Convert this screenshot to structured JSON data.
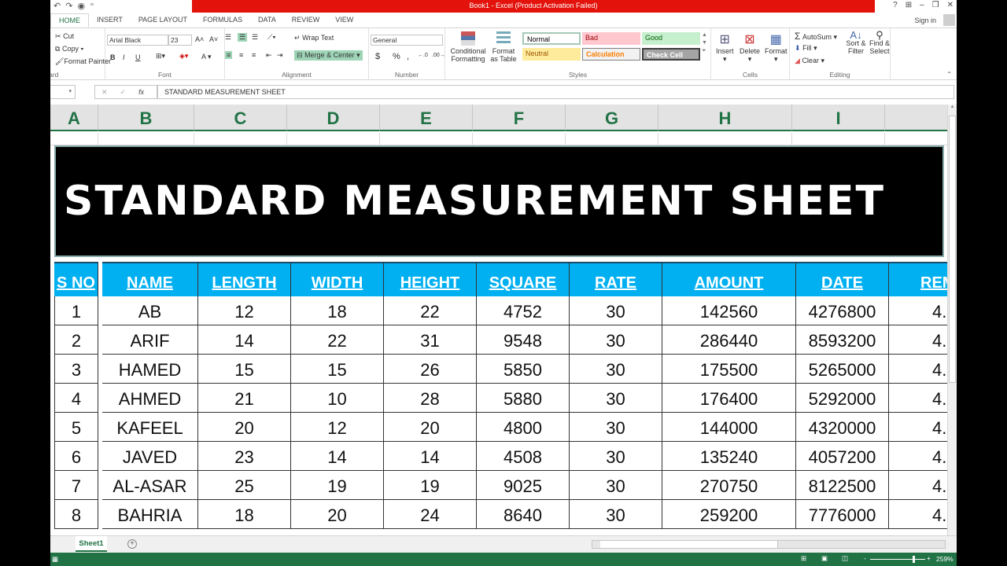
{
  "titlebar": {
    "title": "Book1 -  Excel (Product Activation Failed)",
    "qat": {
      "undo": "↶",
      "redo": "↷",
      "touch": "◉",
      "customize": "⁼"
    },
    "controls": {
      "help": "?",
      "ribbon_options": "⊞",
      "minimize": "–",
      "restore": "❐",
      "close": "✕"
    }
  },
  "tabs": [
    {
      "label": "HOME",
      "active": true
    },
    {
      "label": "INSERT"
    },
    {
      "label": "PAGE LAYOUT"
    },
    {
      "label": "FORMULAS"
    },
    {
      "label": "DATA"
    },
    {
      "label": "REVIEW"
    },
    {
      "label": "VIEW"
    }
  ],
  "account": {
    "sign_in": "Sign in"
  },
  "ribbon": {
    "clipboard": {
      "label": "Clipboard",
      "cut": "Cut",
      "copy": "Copy",
      "format_painter": "Format Painter"
    },
    "font": {
      "label": "Font",
      "font_name": "Arial Black",
      "font_size": "23",
      "grow": "A˄",
      "shrink": "A˅",
      "bold": "B",
      "italic": "I",
      "underline": "U",
      "font_color": "A"
    },
    "alignment": {
      "label": "Alignment",
      "wrap_text": "Wrap Text",
      "merge_center": "Merge & Center"
    },
    "number": {
      "label": "Number",
      "format": "General",
      "currency": "$",
      "percent": "%",
      "comma": ",",
      "inc_decimal": "←.0",
      "dec_decimal": ".00→"
    },
    "styles": {
      "label": "Styles",
      "conditional_formatting": "Conditional Formatting",
      "format_as_table": "Format as Table",
      "gallery": [
        {
          "label": "Normal",
          "bg": "#ffffff",
          "fg": "#000000"
        },
        {
          "label": "Bad",
          "bg": "#ffc7ce",
          "fg": "#9c0006"
        },
        {
          "label": "Good",
          "bg": "#c6efce",
          "fg": "#006100"
        },
        {
          "label": "Neutral",
          "bg": "#ffeb9c",
          "fg": "#9c5700"
        },
        {
          "label": "Calculation",
          "bg": "#f2f2f2",
          "fg": "#fa7d00"
        },
        {
          "label": "Check Cell",
          "bg": "#a5a5a5",
          "fg": "#ffffff"
        }
      ]
    },
    "cells": {
      "label": "Cells",
      "insert": "Insert",
      "delete": "Delete",
      "format": "Format"
    },
    "editing": {
      "label": "Editing",
      "autosum": "AutoSum",
      "fill": "Fill",
      "clear": "Clear",
      "sort_filter": "Sort & Filter",
      "find_select": "Find & Select"
    }
  },
  "formula_bar": {
    "name_box": "",
    "fx": "fx",
    "cancel": "✕",
    "enter": "✓",
    "value": "STANDARD MEASUREMENT SHEET"
  },
  "columns": [
    "A",
    "B",
    "C",
    "D",
    "E",
    "F",
    "G",
    "H",
    "I",
    ""
  ],
  "banner_title": "STANDARD MEASUREMENT SHEET",
  "table": {
    "headers": [
      "S NO",
      "NAME",
      "LENGTH",
      "WIDTH",
      "HEIGHT",
      "SQUARE",
      "RATE",
      "AMOUNT",
      "DATE",
      "REM"
    ],
    "header_color": "#00b0f0",
    "rows": [
      [
        "1",
        "AB",
        "12",
        "18",
        "22",
        "4752",
        "30",
        "142560",
        "4276800",
        "4."
      ],
      [
        "2",
        "ARIF",
        "14",
        "22",
        "31",
        "9548",
        "30",
        "286440",
        "8593200",
        "4."
      ],
      [
        "3",
        "HAMED",
        "15",
        "15",
        "26",
        "5850",
        "30",
        "175500",
        "5265000",
        "4."
      ],
      [
        "4",
        "AHMED",
        "21",
        "10",
        "28",
        "5880",
        "30",
        "176400",
        "5292000",
        "4."
      ],
      [
        "5",
        "KAFEEL",
        "20",
        "12",
        "20",
        "4800",
        "30",
        "144000",
        "4320000",
        "4."
      ],
      [
        "6",
        "JAVED",
        "23",
        "14",
        "14",
        "4508",
        "30",
        "135240",
        "4057200",
        "4."
      ],
      [
        "7",
        "AL-ASAR",
        "25",
        "19",
        "19",
        "9025",
        "30",
        "270750",
        "8122500",
        "4."
      ],
      [
        "8",
        "BAHRIA",
        "18",
        "20",
        "24",
        "8640",
        "30",
        "259200",
        "7776000",
        "4."
      ]
    ]
  },
  "sheet_tabs": [
    {
      "label": "Sheet1",
      "active": true
    }
  ],
  "add_sheet": "+",
  "status": {
    "zoom": "259%",
    "zoom_minus": "-",
    "zoom_plus": "+",
    "zoom_level_percent": 259
  },
  "colors": {
    "accent": "#217346",
    "title_red": "#e3120b"
  }
}
